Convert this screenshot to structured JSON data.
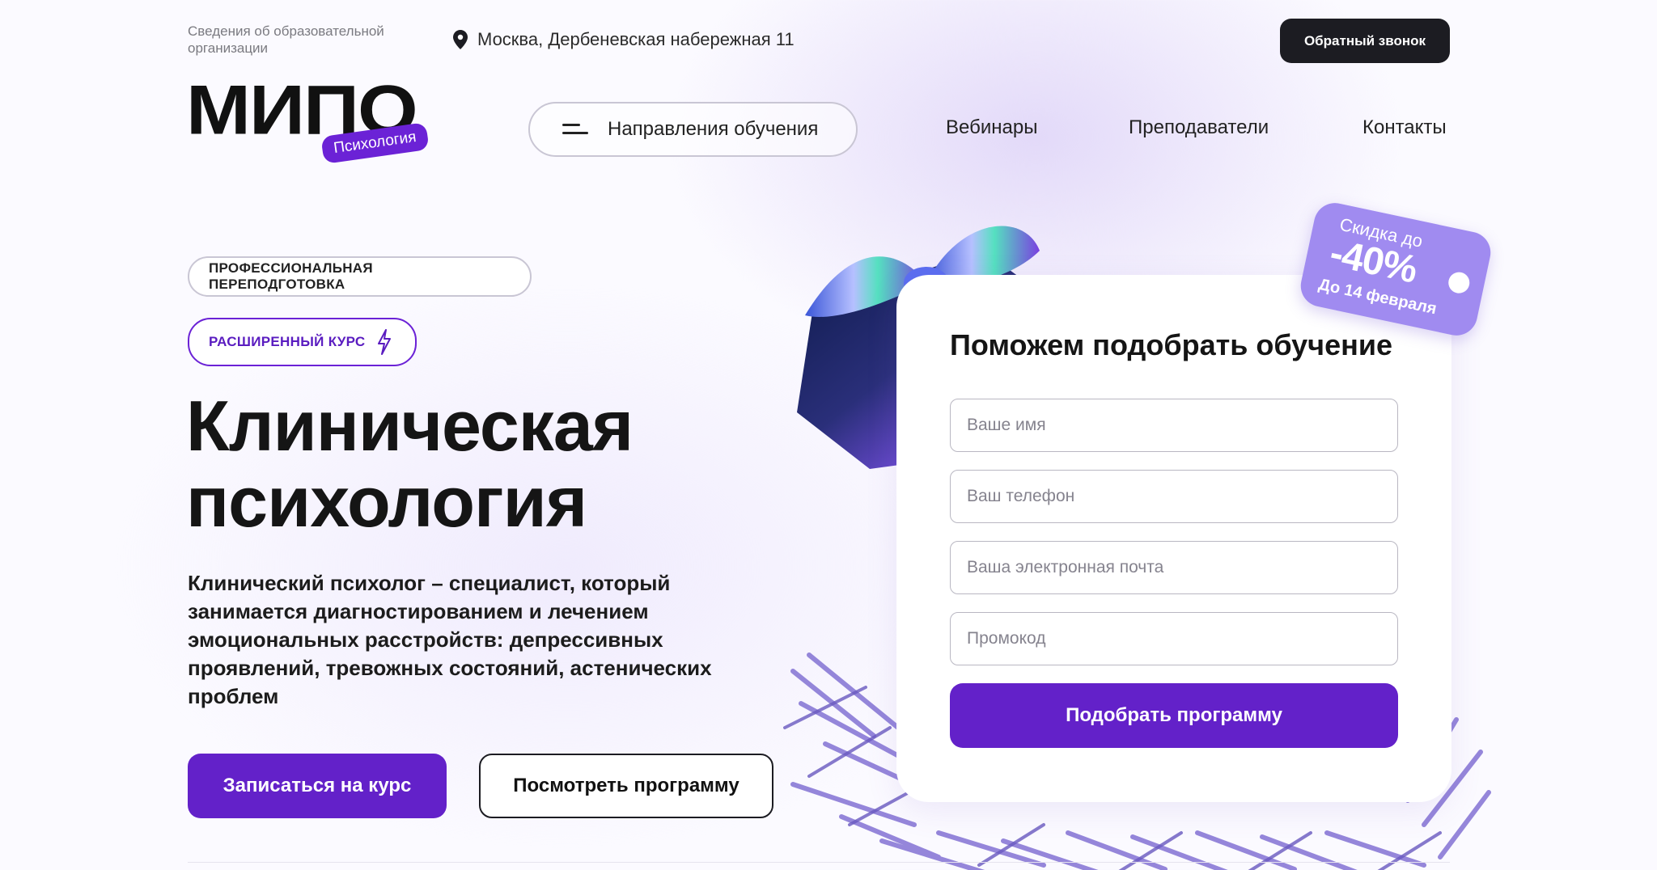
{
  "header": {
    "org_info": "Сведения об образовательной организации",
    "address": "Москва, Дербеневская набережная 11",
    "callback": "Обратный звонок"
  },
  "logo": {
    "word": "МИПО",
    "badge": "Психология"
  },
  "nav": {
    "directions": "Направления обучения",
    "webinars": "Вебинары",
    "teachers": "Преподаватели",
    "contacts": "Контакты"
  },
  "hero": {
    "tag_1": "ПРОФЕССИОНАЛЬНАЯ ПЕРЕПОДГОТОВКА",
    "tag_2": "РАСШИРЕННЫЙ КУРС",
    "title_line_1": "Клиническая",
    "title_line_2": "психология",
    "description": "Клинический психолог – специалист, который занимается диагностированием и лечением эмоциональных расстройств: депрессивных проявлений, тревожных состояний, астенических проблем",
    "btn_enroll": "Записаться на курс",
    "btn_program": "Посмотреть программу"
  },
  "form": {
    "title": "Поможем подобрать обучение",
    "name_placeholder": "Ваше имя",
    "phone_placeholder": "Ваш телефон",
    "email_placeholder": "Ваша электронная почта",
    "promo_placeholder": "Промокод",
    "submit": "Подобрать программу"
  },
  "discount": {
    "top": "Скидка до",
    "value": "-40%",
    "until": "До 14 февраля"
  },
  "colors": {
    "accent": "#6321c9",
    "dark": "#1c1c22",
    "discount_bg": "#a08bf0"
  }
}
